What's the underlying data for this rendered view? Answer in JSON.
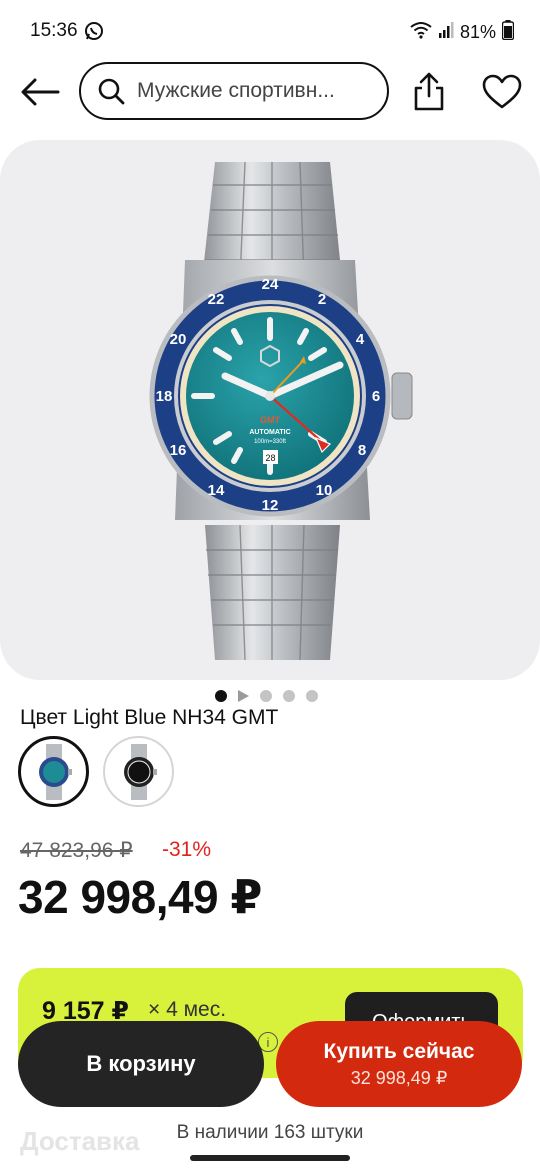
{
  "status": {
    "time": "15:36",
    "battery": "81%",
    "icons": [
      "whatsapp-icon",
      "wifi-icon",
      "signal-icon",
      "battery-icon"
    ]
  },
  "header": {
    "search_value": "Мужские спортивн...",
    "icons": [
      "back-arrow-icon",
      "search-icon",
      "share-icon",
      "heart-icon"
    ]
  },
  "gallery": {
    "total_images": 5,
    "current_index": 1,
    "has_video": true
  },
  "watch_dial": {
    "brand_text": "GMT",
    "model_text": "AUTOMATIC",
    "depth_text": "100m=330ft",
    "date": "28",
    "bezel_numbers": [
      "24",
      "4",
      "8",
      "12",
      "16",
      "20",
      "22",
      "2",
      "6",
      "10",
      "14",
      "18"
    ]
  },
  "product": {
    "color_label": "Цвет Light Blue NH34 GMT",
    "variants": [
      {
        "name": "Light Blue",
        "selected": true
      },
      {
        "name": "Black",
        "selected": false
      }
    ]
  },
  "pricing": {
    "old_price": "47 823,96 ₽",
    "discount": "-31%",
    "price": "32 998,49 ₽"
  },
  "installment": {
    "amount": "9 157 ₽",
    "months": "× 4 мес.",
    "button_label": "Оформить"
  },
  "actions": {
    "cart_label": "В корзину",
    "buy_label": "Купить сейчас",
    "buy_price": "32 998,49 ₽"
  },
  "stock_text": "В наличии 163 штуки",
  "delivery_text": "Доставка",
  "colors": {
    "accent_red": "#d2290f",
    "installment_green": "#d8f23c",
    "dial_teal": "#15868f",
    "bezel_blue": "#1d3f86"
  }
}
